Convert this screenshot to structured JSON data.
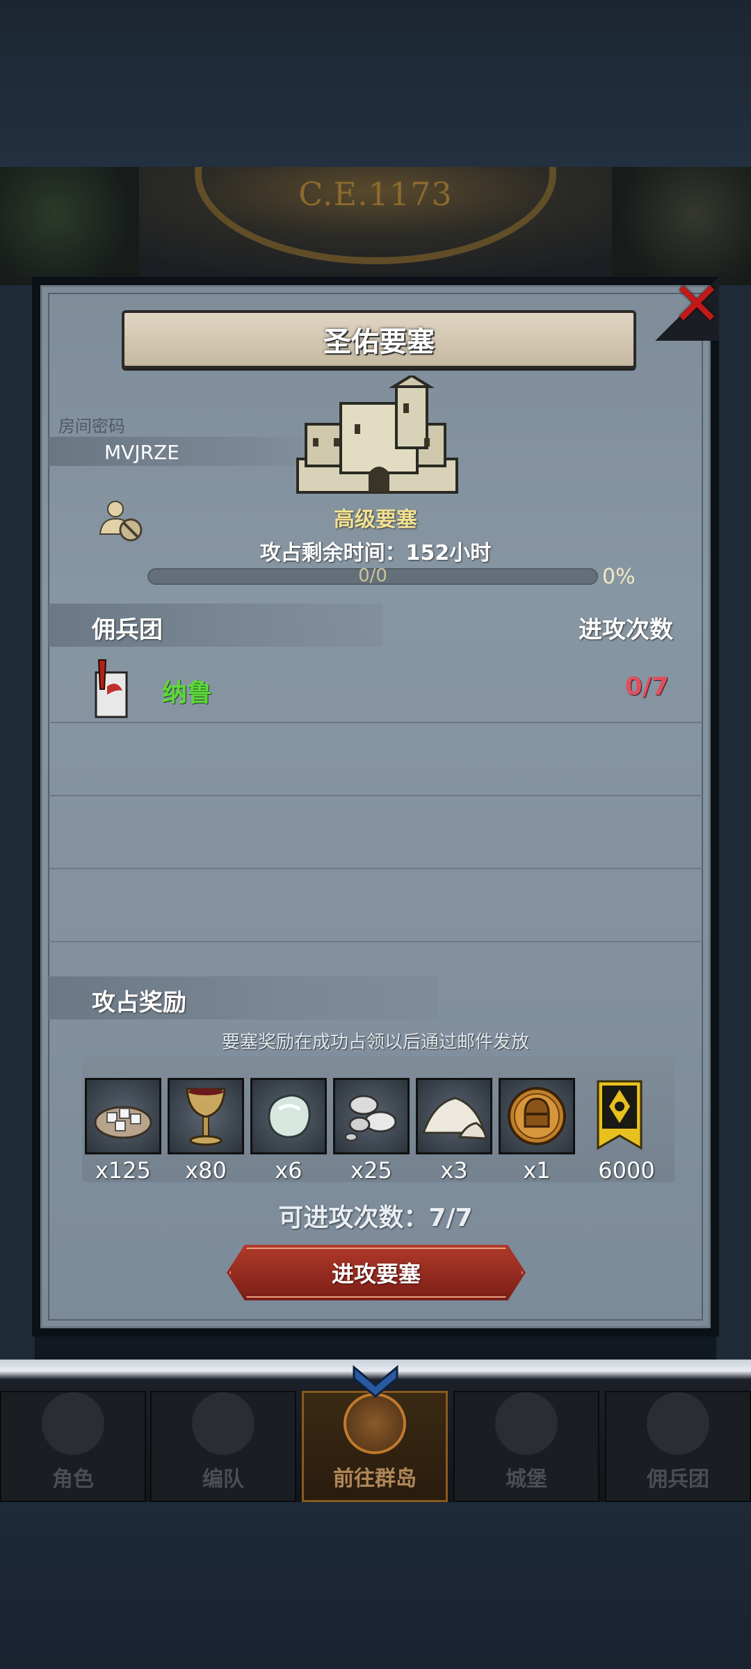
{
  "banner": {
    "year": "C.E.1173"
  },
  "dialog": {
    "title": "圣佑要塞",
    "room_label": "房间密码",
    "room_code": "MVJRZE",
    "castle_name": "高级要塞",
    "time_left": "攻占剩余时间：152小时",
    "progress_text": "0/0",
    "progress_percent": "0%",
    "progress_value": 0,
    "mercenary_header": "佣兵团",
    "attack_count_header": "进攻次数",
    "mercenaries": [
      {
        "name": "纳鲁",
        "attempts": "0/7"
      }
    ],
    "reward_header": "攻占奖励",
    "reward_note": "要塞奖励在成功占领以后通过邮件发放",
    "rewards": [
      {
        "icon": "silver-ore-sack-icon",
        "qty": "x125"
      },
      {
        "icon": "goblet-icon",
        "qty": "x80"
      },
      {
        "icon": "moonstone-icon",
        "qty": "x6"
      },
      {
        "icon": "silver-nuggets-icon",
        "qty": "x25"
      },
      {
        "icon": "salt-pile-icon",
        "qty": "x3"
      },
      {
        "icon": "helmet-coin-icon",
        "qty": "x1"
      },
      {
        "icon": "banner-emblem-icon",
        "qty": "6000"
      }
    ],
    "can_attack": "可进攻次数：7/7",
    "attack_button": "进攻要塞"
  },
  "navbar": {
    "items": [
      {
        "label": "角色",
        "icon": "knight-icon"
      },
      {
        "label": "编队",
        "icon": "helmet-icon"
      },
      {
        "label": "前往群岛",
        "icon": "map-globe-icon",
        "active": true
      },
      {
        "label": "城堡",
        "icon": "castle-icon"
      },
      {
        "label": "佣兵团",
        "icon": "mercenary-icon"
      }
    ]
  },
  "colors": {
    "accent_red": "#b03a2a",
    "merc_name": "#5dd83a",
    "attempts": "#e05060",
    "gold_text": "#f0e090"
  }
}
